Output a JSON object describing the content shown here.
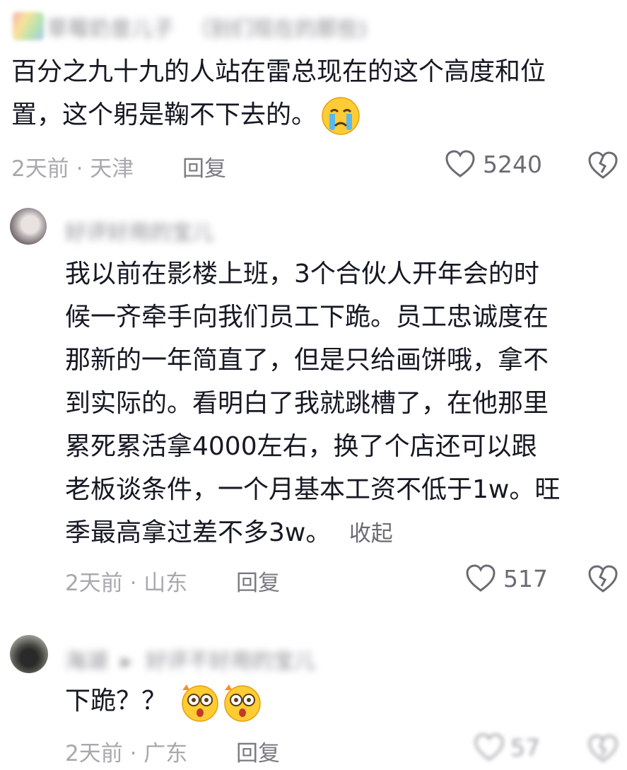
{
  "comments": [
    {
      "username": "草莓奶昔儿子",
      "reply_tag": "（别们现在的那些)",
      "text_lines": [
        "百分之九十九的人站在雷总现在的这个高度和位",
        "置，这个躬是鞠不下去的。"
      ],
      "emoji": "crying-face",
      "time": "2天前",
      "location": "天津",
      "reply_label": "回复",
      "likes": "5240"
    },
    {
      "username": "好评好用的宝儿",
      "text_lines": [
        "我以前在影楼上班，3个合伙人开年会的时",
        "候一齐牵手向我们员工下跪。员工忠诚度在",
        "那新的一年简直了，但是只给画饼哦，拿不",
        "到实际的。看明白了我就跳槽了，在他那里",
        "累死累活拿4000左右，换了个店还可以跟",
        "老板谈条件，一个月基本工资不低于1w。旺",
        "季最高拿过差不多3w。"
      ],
      "collapse_label": "收起",
      "time": "2天前",
      "location": "山东",
      "reply_label": "回复",
      "likes": "517"
    },
    {
      "username": "海湖",
      "reply_to": "好评不好用的宝儿",
      "text": "下跪？？",
      "emoji": "flushed-face",
      "time": "2天前",
      "location": "广东",
      "reply_label": "回复",
      "likes": "57"
    }
  ],
  "separator": " · ",
  "colors": {
    "text": "#161823",
    "meta": "#a8a8ae",
    "icon": "#6b6b73"
  }
}
